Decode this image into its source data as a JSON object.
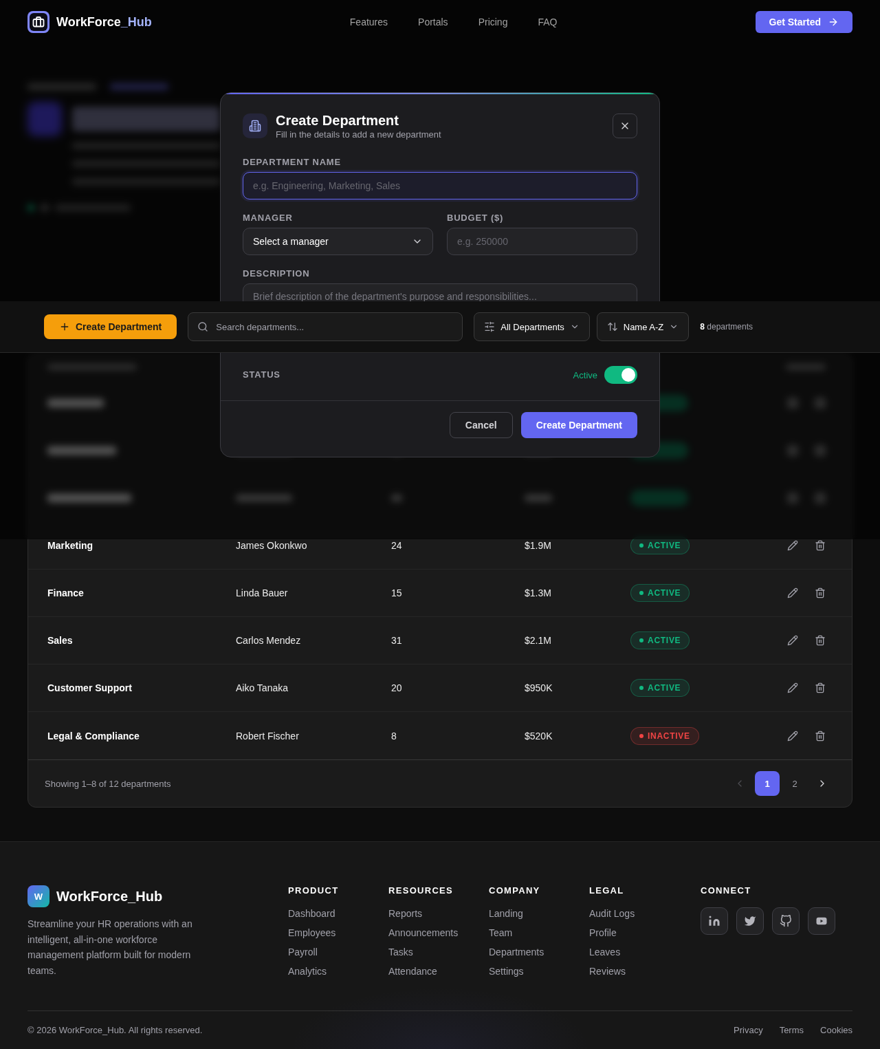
{
  "nav": {
    "brand": {
      "name": "WorkForce",
      "suffix": "_Hub"
    },
    "links": [
      "Features",
      "Portals",
      "Pricing",
      "FAQ"
    ],
    "cta": "Get Started"
  },
  "modal": {
    "title": "Create Department",
    "subtitle": "Fill in the details to add a new department",
    "name_field": {
      "label": "DEPARTMENT NAME",
      "placeholder": "e.g. Engineering, Marketing, Sales",
      "focused": true
    },
    "manager_field": {
      "label": "MANAGER",
      "value": "Select a manager"
    },
    "budget_field": {
      "label": "BUDGET ($)",
      "placeholder": "e.g. 250000"
    },
    "description_field": {
      "label": "DESCRIPTION",
      "placeholder": "Brief description of the department's purpose and responsibilities..."
    },
    "status": {
      "label": "STATUS",
      "value": "Active",
      "on": true
    },
    "buttons": [
      {
        "label": "Cancel",
        "kind": "secondary"
      },
      {
        "label": "Create Department",
        "kind": "primary"
      }
    ]
  },
  "toolbar": {
    "create_button": "Create Department",
    "search": {
      "placeholder": "Search departments..."
    },
    "filter": "All Departments",
    "sort": "Name A-Z",
    "count": "**8** departments"
  },
  "table": {
    "rows": [
      {
        "name": "Marketing",
        "manager": "James Okonkwo",
        "employees": "24",
        "budget": "$1.9M",
        "status": {
          "label": "ACTIVE",
          "color": "#10b981"
        }
      },
      {
        "name": "Finance",
        "manager": "Linda Bauer",
        "employees": "15",
        "budget": "$1.3M",
        "status": {
          "label": "ACTIVE",
          "color": "#10b981"
        }
      },
      {
        "name": "Sales",
        "manager": "Carlos Mendez",
        "employees": "31",
        "budget": "$2.1M",
        "status": {
          "label": "ACTIVE",
          "color": "#10b981"
        }
      },
      {
        "name": "Customer Support",
        "manager": "Aiko Tanaka",
        "employees": "20",
        "budget": "$950K",
        "status": {
          "label": "ACTIVE",
          "color": "#10b981"
        }
      },
      {
        "name": "Legal & Compliance",
        "manager": "Robert Fischer",
        "employees": "8",
        "budget": "$520K",
        "status": {
          "label": "INACTIVE",
          "color": "#ef4444"
        }
      }
    ],
    "footer": {
      "summary": "Showing 1–8 of 12 departments",
      "prev": {
        "disabled": true
      },
      "pages": [
        {
          "label": "1",
          "selected": true
        },
        {
          "label": "2",
          "selected": false
        }
      ],
      "next": {
        "disabled": false
      }
    }
  },
  "footer": {
    "brand": {
      "logo": "W",
      "name": "WorkForce_Hub",
      "description": "Streamline your HR operations with an intelligent, all-in-one workforce management platform built for modern teams."
    },
    "columns": [
      {
        "title": "PRODUCT",
        "links": [
          "Dashboard",
          "Employees",
          "Payroll",
          "Analytics"
        ]
      },
      {
        "title": "RESOURCES",
        "links": [
          "Reports",
          "Announcements",
          "Tasks",
          "Attendance"
        ]
      },
      {
        "title": "COMPANY",
        "links": [
          "Landing",
          "Team",
          "Departments",
          "Settings"
        ]
      },
      {
        "title": "LEGAL",
        "links": [
          "Audit Logs",
          "Profile",
          "Leaves",
          "Reviews"
        ]
      }
    ],
    "connect": {
      "title": "CONNECT"
    },
    "copyright": "© 2026 WorkForce_Hub. All rights reserved.",
    "legal_links": [
      "Privacy",
      "Terms",
      "Cookies"
    ]
  }
}
